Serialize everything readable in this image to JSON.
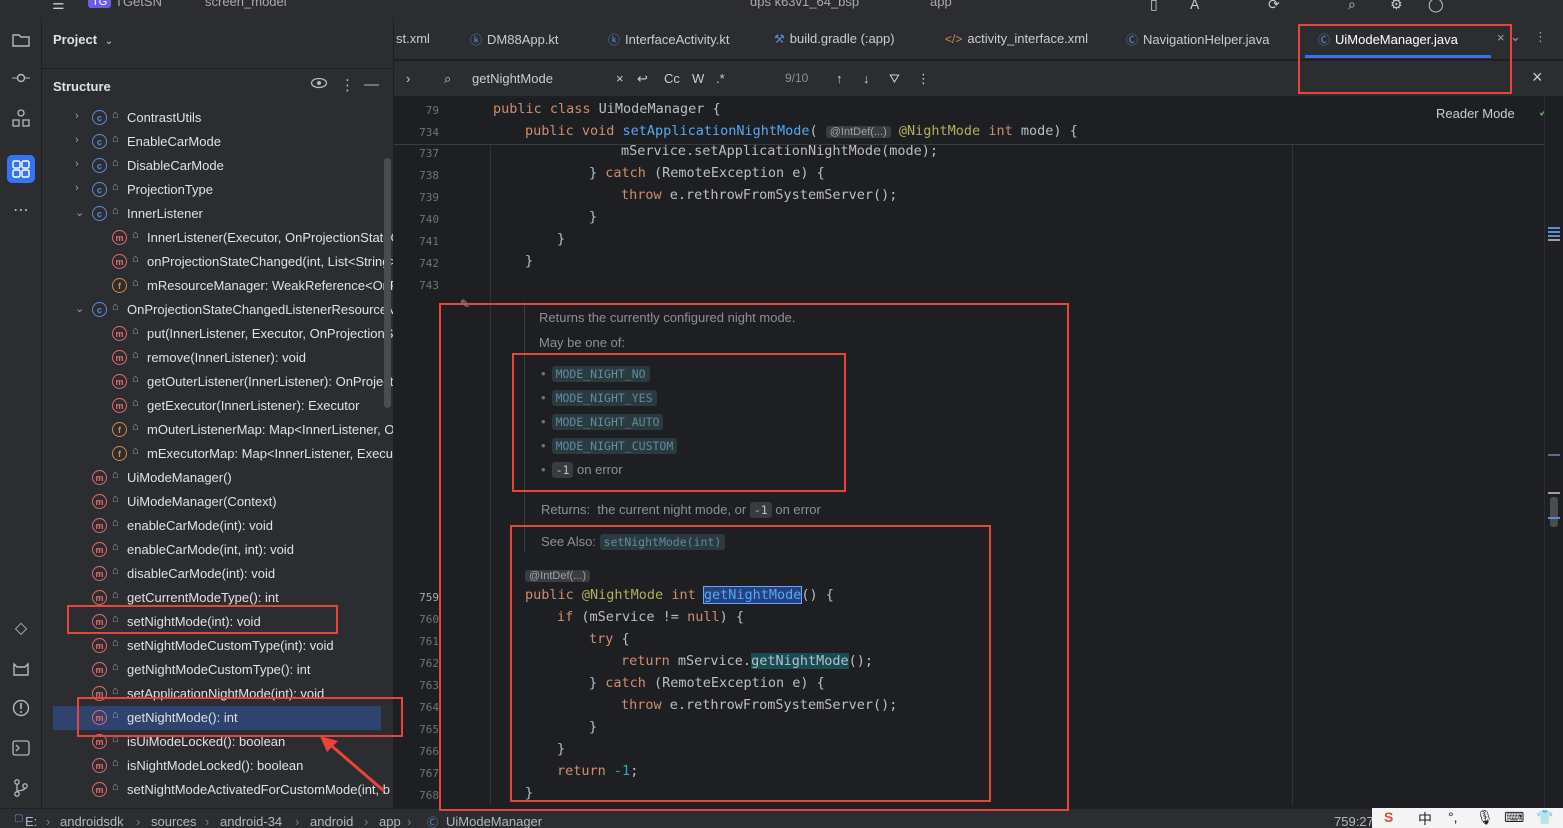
{
  "titlebar": {
    "project_badge": "TG",
    "project_name": "TGetSN",
    "branch": "screen_model",
    "device": "dps k63v1_64_bsp",
    "run_config": "app"
  },
  "toolstrip": {
    "icons": [
      "folder-icon",
      "commit-icon",
      "structure-icon",
      "pull-requests-icon",
      "more-icon",
      "gem-icon",
      "cat-icon",
      "problems-icon",
      "terminal-icon",
      "git-icon"
    ]
  },
  "project_panel": {
    "title": "Project",
    "structure_title": "Structure",
    "tree": [
      {
        "label": "ContrastUtils",
        "kind": "c",
        "level": 1,
        "expanded": false
      },
      {
        "label": "EnableCarMode",
        "kind": "c",
        "level": 1,
        "expanded": false
      },
      {
        "label": "DisableCarMode",
        "kind": "c",
        "level": 1,
        "expanded": false
      },
      {
        "label": "ProjectionType",
        "kind": "c",
        "level": 1,
        "expanded": false
      },
      {
        "label": "InnerListener",
        "kind": "c",
        "level": 1,
        "expanded": true
      },
      {
        "label": "InnerListener(Executor, OnProjectionStateC",
        "kind": "m",
        "level": 2
      },
      {
        "label": "onProjectionStateChanged(int, List<String>",
        "kind": "m",
        "level": 2
      },
      {
        "label": "mResourceManager: WeakReference<OnP",
        "kind": "f",
        "level": 2
      },
      {
        "label": "OnProjectionStateChangedListenerResourceM",
        "kind": "c",
        "level": 1,
        "expanded": true
      },
      {
        "label": "put(InnerListener, Executor, OnProjectionSt",
        "kind": "m",
        "level": 2
      },
      {
        "label": "remove(InnerListener): void",
        "kind": "m",
        "level": 2
      },
      {
        "label": "getOuterListener(InnerListener): OnProjecti",
        "kind": "m",
        "level": 2
      },
      {
        "label": "getExecutor(InnerListener): Executor",
        "kind": "m",
        "level": 2
      },
      {
        "label": "mOuterListenerMap: Map<InnerListener, O",
        "kind": "f",
        "level": 2
      },
      {
        "label": "mExecutorMap: Map<InnerListener, Execu",
        "kind": "f",
        "level": 2
      },
      {
        "label": "UiModeManager()",
        "kind": "m",
        "level": 1
      },
      {
        "label": "UiModeManager(Context)",
        "kind": "m",
        "level": 1
      },
      {
        "label": "enableCarMode(int): void",
        "kind": "m",
        "level": 1
      },
      {
        "label": "enableCarMode(int, int): void",
        "kind": "m",
        "level": 1
      },
      {
        "label": "disableCarMode(int): void",
        "kind": "m",
        "level": 1
      },
      {
        "label": "getCurrentModeType(): int",
        "kind": "m",
        "level": 1
      },
      {
        "label": "setNightMode(int): void",
        "kind": "m",
        "level": 1
      },
      {
        "label": "setNightModeCustomType(int): void",
        "kind": "m",
        "level": 1
      },
      {
        "label": "getNightModeCustomType(): int",
        "kind": "m",
        "level": 1
      },
      {
        "label": "setApplicationNightMode(int): void",
        "kind": "m",
        "level": 1
      },
      {
        "label": "getNightMode(): int",
        "kind": "m",
        "level": 1,
        "selected": true
      },
      {
        "label": "isUiModeLocked(): boolean",
        "kind": "m",
        "level": 1
      },
      {
        "label": "isNightModeLocked(): boolean",
        "kind": "m",
        "level": 1
      },
      {
        "label": "setNightModeActivatedForCustomMode(int, b",
        "kind": "m",
        "level": 1
      }
    ]
  },
  "tabs": [
    {
      "label": "st.xml",
      "icon": ""
    },
    {
      "label": "DM88App.kt",
      "icon": "kotlin-class-icon"
    },
    {
      "label": "InterfaceActivity.kt",
      "icon": "kotlin-class-icon"
    },
    {
      "label": "build.gradle (:app)",
      "icon": "gradle-icon"
    },
    {
      "label": "activity_interface.xml",
      "icon": "xml-icon"
    },
    {
      "label": "NavigationHelper.java",
      "icon": "class-icon"
    },
    {
      "label": "UiModeManager.java",
      "icon": "class-icon",
      "active": true
    }
  ],
  "findbar": {
    "query": "getNightMode",
    "match_case": "Cc",
    "words": "W",
    "regex": ".*",
    "count": "9/10"
  },
  "editor": {
    "reader_mode": "Reader Mode",
    "sticky": [
      {
        "ln": "79",
        "text": "public class UiModeManager {"
      },
      {
        "ln": "734",
        "text": "public void setApplicationNightMode("
      }
    ],
    "sticky_hint": "@IntDef(...)",
    "sticky_rest": "@NightMode int mode) {",
    "lines_top": [
      {
        "ln": "737",
        "text": "mService.setApplicationNightMode(mode);"
      },
      {
        "ln": "738",
        "text": "} catch (RemoteException e) {"
      },
      {
        "ln": "739",
        "text": "throw e.rethrowFromSystemServer();"
      },
      {
        "ln": "740",
        "text": "}"
      },
      {
        "ln": "741",
        "text": "}"
      },
      {
        "ln": "742",
        "text": "}"
      },
      {
        "ln": "743",
        "text": ""
      }
    ],
    "doc": {
      "summary": "Returns the currently configured night mode.",
      "may_be": "May be one of:",
      "options": [
        "MODE_NIGHT_NO",
        "MODE_NIGHT_YES",
        "MODE_NIGHT_AUTO",
        "MODE_NIGHT_CUSTOM"
      ],
      "error_code": "-1",
      "error_text": "on error",
      "returns_label": "Returns:",
      "returns_text": "the current night mode, or",
      "returns_code": "-1",
      "returns_tail": "on error",
      "see_also_label": "See Also:",
      "see_also_code": "setNightMode(int)"
    },
    "method_hint": "@IntDef(...)",
    "lines_bottom": [
      {
        "ln": "759"
      },
      {
        "ln": "760"
      },
      {
        "ln": "761"
      },
      {
        "ln": "762"
      },
      {
        "ln": "763"
      },
      {
        "ln": "764"
      },
      {
        "ln": "765"
      },
      {
        "ln": "766"
      },
      {
        "ln": "767"
      },
      {
        "ln": "768"
      }
    ]
  },
  "statusbar": {
    "crumbs": [
      "E:",
      "androidsdk",
      "sources",
      "android-34",
      "android",
      "app",
      "UiModeManager"
    ],
    "position": "759:27"
  },
  "ime": {
    "lang": "中"
  }
}
